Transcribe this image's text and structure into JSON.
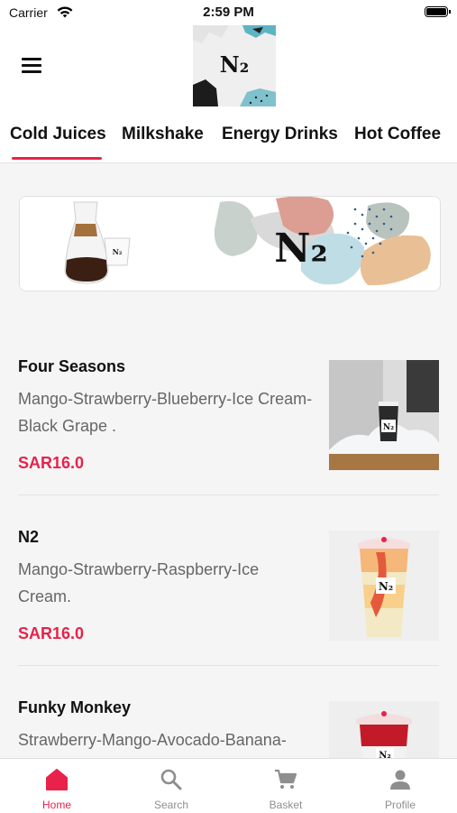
{
  "status_bar": {
    "carrier": "Carrier",
    "time": "2:59 PM"
  },
  "tabs": [
    {
      "label": "Cold Juices",
      "active": true
    },
    {
      "label": "Milkshake",
      "active": false
    },
    {
      "label": "Energy Drinks",
      "active": false
    },
    {
      "label": "Hot Coffee",
      "active": false
    }
  ],
  "logo_text": "N₂",
  "banner_logo_text": "N₂",
  "products": [
    {
      "name": "Four Seasons",
      "description": "Mango-Strawberry-Blueberry-Ice Cream-Black Grape .",
      "price": "SAR16.0"
    },
    {
      "name": "N2",
      "description": "Mango-Strawberry-Raspberry-Ice Cream.",
      "price": "SAR16.0"
    },
    {
      "name": "Funky Monkey",
      "description": "Strawberry-Mango-Avocado-Banana-",
      "price": ""
    }
  ],
  "bottom_nav": [
    {
      "label": "Home",
      "icon": "home-icon",
      "active": true
    },
    {
      "label": "Search",
      "icon": "search-icon",
      "active": false
    },
    {
      "label": "Basket",
      "icon": "cart-icon",
      "active": false
    },
    {
      "label": "Profile",
      "icon": "profile-icon",
      "active": false
    }
  ],
  "colors": {
    "accent": "#e8224a",
    "inactive": "#8e8e8e"
  }
}
